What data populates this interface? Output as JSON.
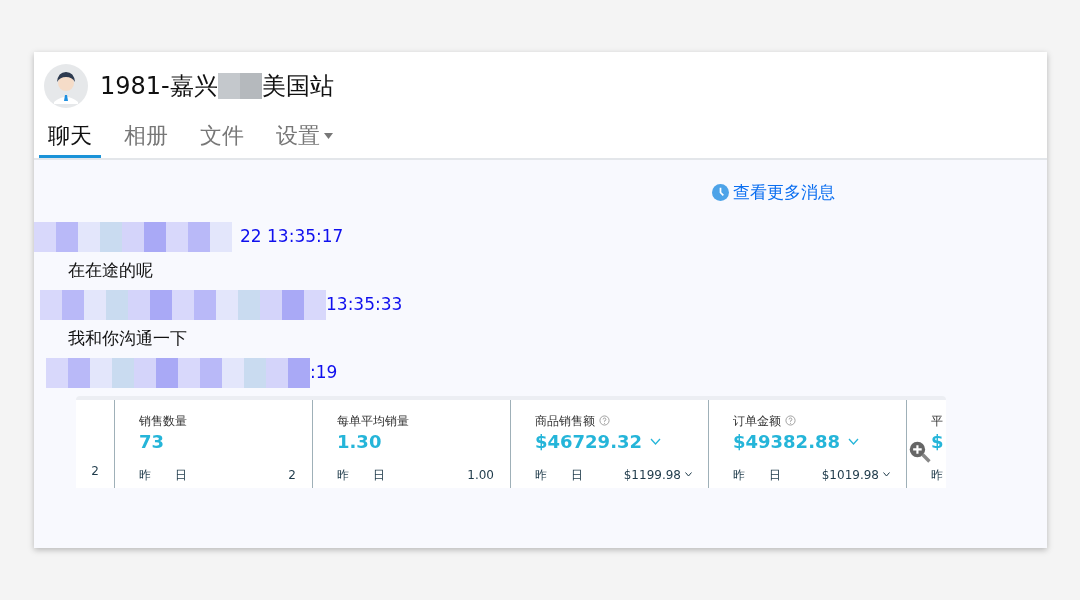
{
  "header": {
    "title_start": "1981-嘉兴",
    "title_end": "美国站"
  },
  "tabs": [
    {
      "label": "聊天",
      "selected": true,
      "dropdown": false
    },
    {
      "label": "相册",
      "selected": false,
      "dropdown": false
    },
    {
      "label": "文件",
      "selected": false,
      "dropdown": false
    },
    {
      "label": "设置",
      "selected": false,
      "dropdown": true
    }
  ],
  "more_messages": "查看更多消息",
  "messages": [
    {
      "time": "22 13:35:17",
      "text": "在在途的呢"
    },
    {
      "time": "13:35:33",
      "text": "我和你沟通一下"
    },
    {
      "time": ":19"
    }
  ],
  "stats": {
    "left_value": "2",
    "cards": [
      {
        "label": "销售数量",
        "help": false,
        "value": "73",
        "caret": false,
        "yesterday_label": "昨　　日",
        "yesterday_value": "2",
        "yesterday_caret": false
      },
      {
        "label": "每单平均销量",
        "help": false,
        "value": "1.30",
        "caret": false,
        "yesterday_label": "昨　　日",
        "yesterday_value": "1.00",
        "yesterday_caret": false
      },
      {
        "label": "商品销售额",
        "help": true,
        "value": "$46729.32",
        "caret": true,
        "yesterday_label": "昨　　日",
        "yesterday_value": "$1199.98",
        "yesterday_caret": true
      },
      {
        "label": "订单金额",
        "help": true,
        "value": "$49382.88",
        "caret": true,
        "yesterday_label": "昨　　日",
        "yesterday_value": "$1019.98",
        "yesterday_caret": true
      }
    ],
    "partial_card": {
      "label": "平",
      "value": "$",
      "yesterday_label": "昨"
    }
  }
}
